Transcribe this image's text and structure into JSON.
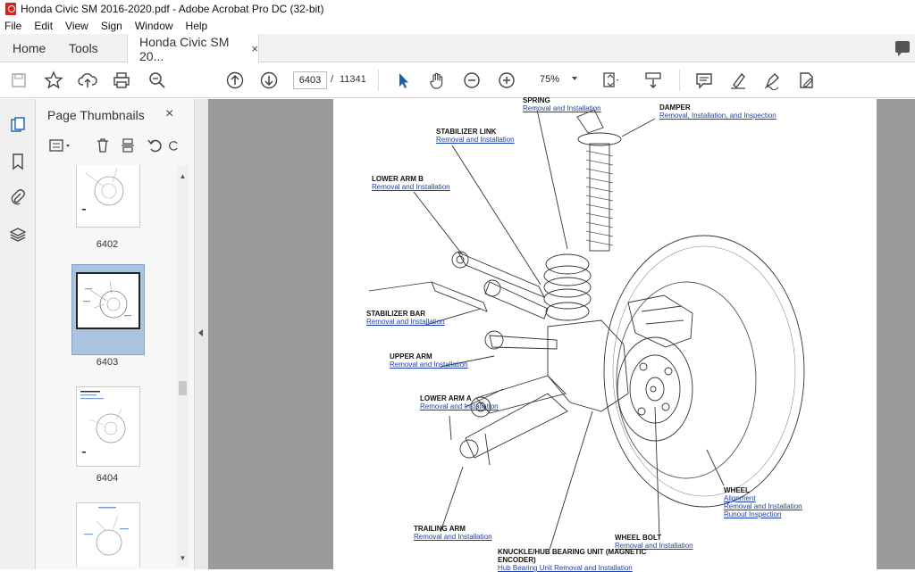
{
  "window": {
    "title": "Honda Civic SM 2016-2020.pdf - Adobe Acrobat Pro DC (32-bit)"
  },
  "menu": [
    "File",
    "Edit",
    "View",
    "Sign",
    "Window",
    "Help"
  ],
  "tabs": {
    "home": "Home",
    "tools": "Tools",
    "document": "Honda Civic SM 20...",
    "close": "×"
  },
  "toolbar": {
    "current_page": "6403",
    "separator": "/",
    "total_pages": "11341",
    "zoom": "75%"
  },
  "panel": {
    "title": "Page Thumbnails",
    "close": "×",
    "thumbnails": [
      {
        "label": "6402",
        "selected": false
      },
      {
        "label": "6403",
        "selected": true
      },
      {
        "label": "6404",
        "selected": false
      },
      {
        "label": "",
        "selected": false
      }
    ]
  },
  "diagram": {
    "labels": [
      {
        "title": "SPRING",
        "links": [
          "Removal and Installation"
        ]
      },
      {
        "title": "DAMPER",
        "links": [
          "Removal, Installation, and Inspection"
        ]
      },
      {
        "title": "STABILIZER LINK",
        "links": [
          "Removal and Installation"
        ]
      },
      {
        "title": "LOWER ARM B",
        "links": [
          "Removal and Installation"
        ]
      },
      {
        "title": "STABILIZER BAR",
        "links": [
          "Removal and Installation"
        ]
      },
      {
        "title": "UPPER ARM",
        "links": [
          "Removal and Installation"
        ]
      },
      {
        "title": "LOWER ARM A",
        "links": [
          "Removal and Installation"
        ]
      },
      {
        "title": "WHEEL",
        "links": [
          "Alignment",
          "Removal and Installation",
          "Runout Inspection"
        ]
      },
      {
        "title": "TRAILING ARM",
        "links": [
          "Removal and Installation"
        ]
      },
      {
        "title": "WHEEL BOLT",
        "links": [
          "Removal and Installation"
        ]
      },
      {
        "title": "KNUCKLE/HUB BEARING UNIT (MAGNETIC ENCODER)",
        "links": [
          "Hub Bearing Unit Removal and Installation"
        ]
      }
    ]
  }
}
